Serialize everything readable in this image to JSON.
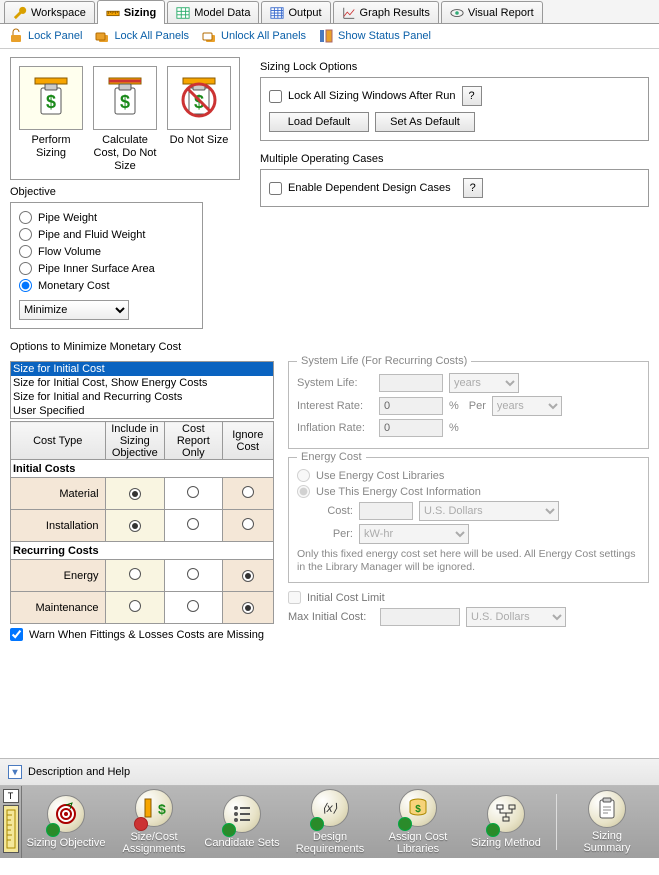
{
  "tabs": {
    "workspace": "Workspace",
    "sizing": "Sizing",
    "modeldata": "Model Data",
    "output": "Output",
    "graph": "Graph Results",
    "visual": "Visual Report"
  },
  "toolbar": {
    "lock_panel": "Lock Panel",
    "lock_all": "Lock All Panels",
    "unlock_all": "Unlock All Panels",
    "show_status": "Show Status Panel"
  },
  "size_actions": {
    "perform": "Perform Sizing",
    "calc": "Calculate Cost, Do Not Size",
    "donot": "Do Not Size"
  },
  "lock_opts": {
    "title": "Sizing Lock Options",
    "lock_after_run": "Lock All Sizing Windows After Run",
    "load_default": "Load Default",
    "set_default": "Set As Default"
  },
  "multi": {
    "title": "Multiple Operating Cases",
    "enable": "Enable Dependent Design Cases"
  },
  "objective": {
    "title": "Objective",
    "opts": {
      "weight": "Pipe Weight",
      "pfweight": "Pipe and Fluid Weight",
      "flow": "Flow Volume",
      "surf": "Pipe Inner Surface Area",
      "monetary": "Monetary Cost"
    },
    "minmax": "Minimize"
  },
  "options_title": "Options to Minimize Monetary Cost",
  "list": {
    "i0": "Size for Initial Cost",
    "i1": "Size for Initial Cost, Show Energy Costs",
    "i2": "Size for Initial and Recurring Costs",
    "i3": "User Specified"
  },
  "table": {
    "h_costtype": "Cost Type",
    "h_include": "Include in Sizing Objective",
    "h_report": "Cost Report Only",
    "h_ignore": "Ignore Cost",
    "sec_initial": "Initial Costs",
    "r_material": "Material",
    "r_install": "Installation",
    "sec_recurring": "Recurring Costs",
    "r_energy": "Energy",
    "r_maint": "Maintenance"
  },
  "warn_label": "Warn When Fittings & Losses Costs are Missing",
  "syslife": {
    "title": "System Life (For Recurring Costs)",
    "syslife_lbl": "System Life:",
    "years": "years",
    "interest_lbl": "Interest Rate:",
    "per_lbl": "Per",
    "inflation_lbl": "Inflation Rate:",
    "interest_val": "0",
    "inflation_val": "0",
    "pct": "%"
  },
  "energy": {
    "title": "Energy Cost",
    "use_lib": "Use Energy Cost Libraries",
    "use_this": "Use This Energy Cost Information",
    "cost_lbl": "Cost:",
    "usd": "U.S. Dollars",
    "per_lbl": "Per:",
    "kwhr": "kW-hr",
    "note": "Only this fixed energy cost set here will be used. All Energy Cost settings in the Library Manager will be ignored."
  },
  "limit": {
    "chk": "Initial Cost Limit",
    "max_lbl": "Max Initial Cost:",
    "usd": "U.S. Dollars"
  },
  "desc_band": "Description and Help",
  "nav": {
    "obj": "Sizing Objective",
    "assign": "Size/Cost Assignments",
    "cand": "Candidate Sets",
    "design": "Design Requirements",
    "costlib": "Assign Cost Libraries",
    "method": "Sizing Method",
    "summary": "Sizing Summary"
  },
  "icon_T": "T"
}
